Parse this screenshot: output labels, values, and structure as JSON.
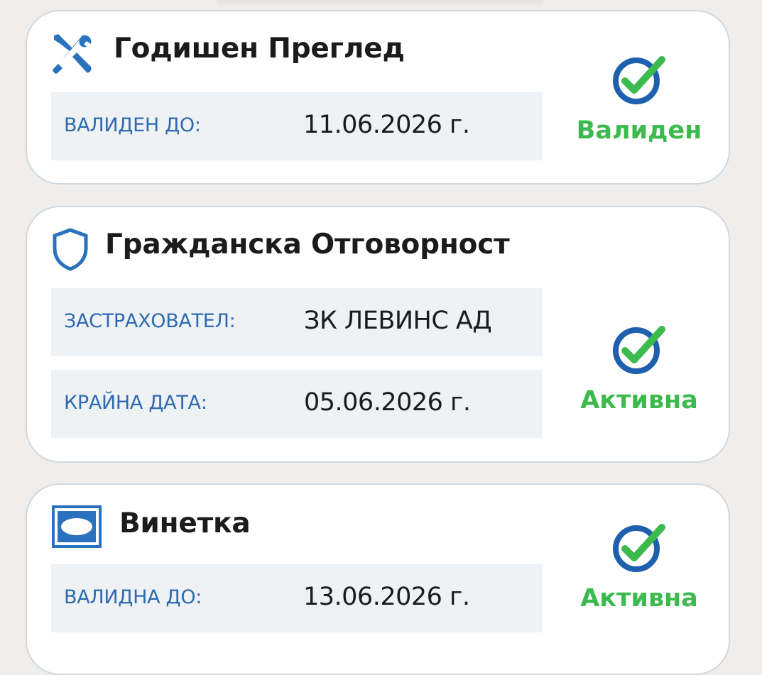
{
  "colors": {
    "label_blue": "#2e6ab2",
    "status_green": "#3dba4e",
    "icon_blue": "#2a72bd",
    "check_ring_blue": "#1e5fae",
    "row_bg": "#eef2f5"
  },
  "cards": [
    {
      "icon": "tools-icon",
      "title": "Годишен Преглед",
      "rows": [
        {
          "label": "ВАЛИДЕН ДО:",
          "value": "11.06.2026 г."
        }
      ],
      "status": {
        "icon": "check-circle-icon",
        "text": "Валиден"
      }
    },
    {
      "icon": "shield-icon",
      "title": "Гражданска Отговорност",
      "rows": [
        {
          "label": "ЗАСТРАХОВАТЕЛ:",
          "value": "ЗК ЛЕВИНС АД"
        },
        {
          "label": "КРАЙНА ДАТА:",
          "value": "05.06.2026 г."
        }
      ],
      "status": {
        "icon": "check-circle-icon",
        "text": "Активна"
      }
    },
    {
      "icon": "vignette-icon",
      "title": "Винетка",
      "rows": [
        {
          "label": "ВАЛИДНА ДО:",
          "value": "13.06.2026 г."
        }
      ],
      "status": {
        "icon": "check-circle-icon",
        "text": "Активна"
      }
    }
  ]
}
